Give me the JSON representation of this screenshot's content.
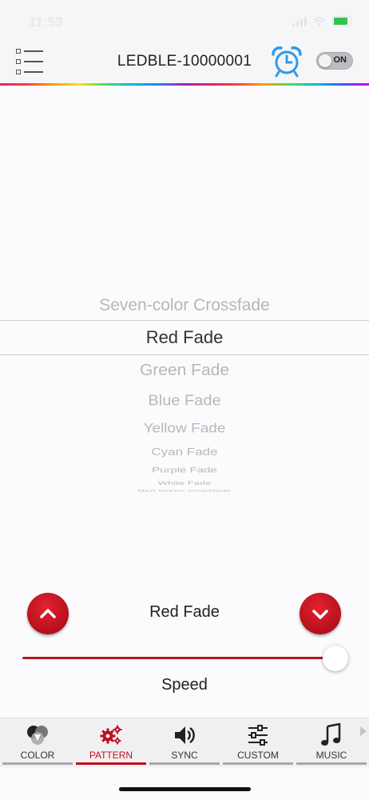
{
  "status": {
    "time": "11:53"
  },
  "header": {
    "title": "LEDBLE-10000001",
    "power_label": "ON"
  },
  "picker": {
    "items": [
      "Seven-color Crossfade",
      "Red Fade",
      "Green Fade",
      "Blue Fade",
      "Yellow Fade",
      "Cyan Fade",
      "Purple Fade",
      "White Fade",
      "Red Green Crossfade"
    ],
    "selected_index": 1
  },
  "controls": {
    "current_pattern": "Red Fade",
    "speed_label": "Speed",
    "speed_value": 0.98
  },
  "tabs": [
    {
      "label": "COLOR",
      "icon": "color-circles-icon"
    },
    {
      "label": "PATTERN",
      "icon": "gears-icon",
      "active": true
    },
    {
      "label": "SYNC",
      "icon": "speaker-icon"
    },
    {
      "label": "CUSTOM",
      "icon": "sliders-icon"
    },
    {
      "label": "MUSIC",
      "icon": "music-note-icon"
    }
  ],
  "colors": {
    "accent": "#c0101c",
    "alarm_blue": "#2e9be8",
    "picker_text_selected": "#333333",
    "picker_text": "#b7b7bb"
  }
}
